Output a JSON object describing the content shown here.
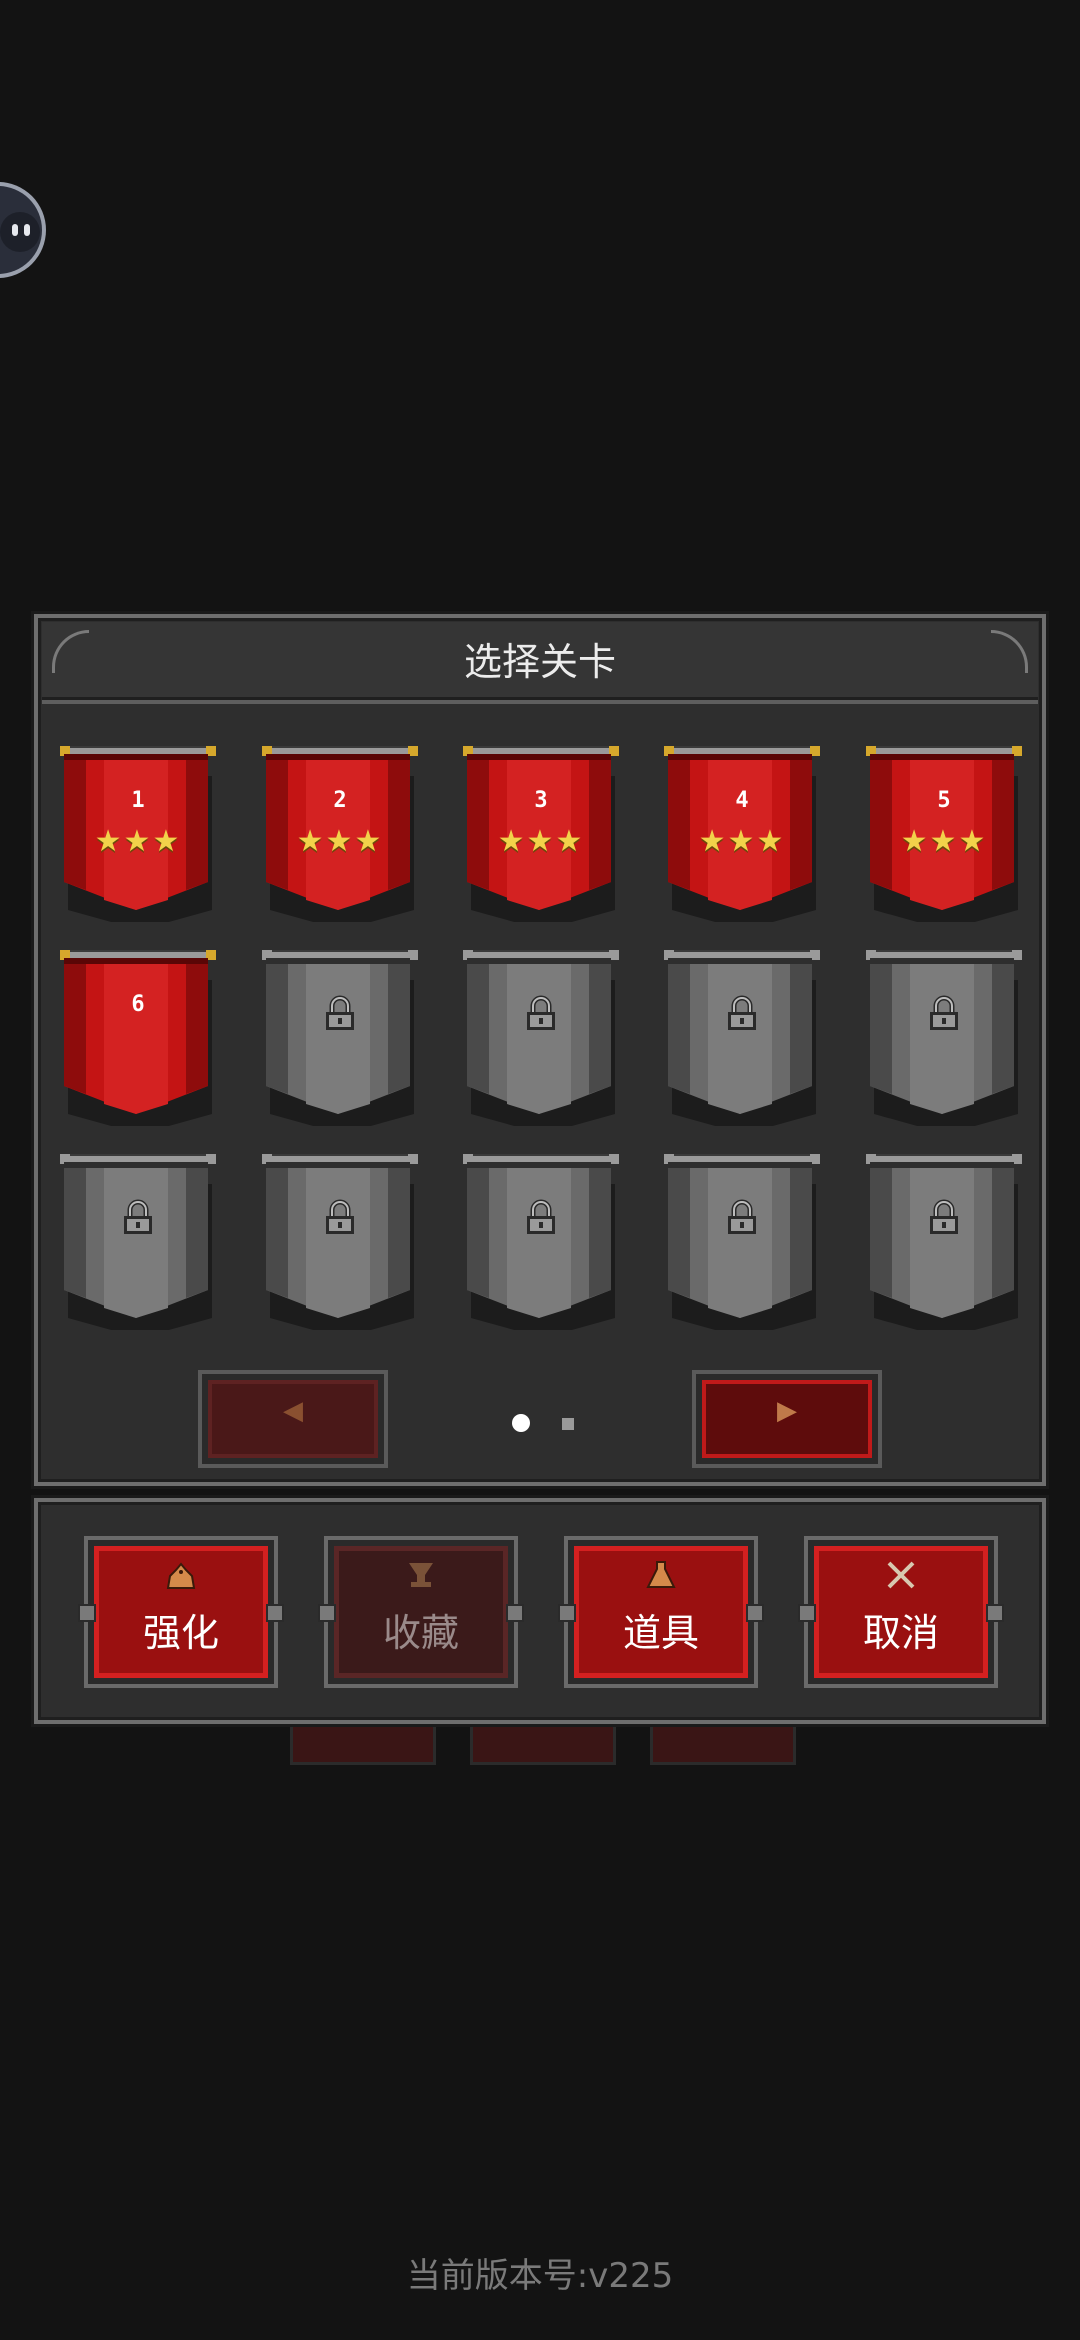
{
  "panel": {
    "title": "选择关卡"
  },
  "levels": [
    {
      "label": "1",
      "state": "cleared",
      "stars": "★★★"
    },
    {
      "label": "2",
      "state": "cleared",
      "stars": "★★★"
    },
    {
      "label": "3",
      "state": "cleared",
      "stars": "★★★"
    },
    {
      "label": "4",
      "state": "cleared",
      "stars": "★★★"
    },
    {
      "label": "5",
      "state": "cleared",
      "stars": "★★★"
    },
    {
      "label": "6",
      "state": "unlocked",
      "stars": ""
    },
    {
      "label": "",
      "state": "locked",
      "stars": ""
    },
    {
      "label": "",
      "state": "locked",
      "stars": ""
    },
    {
      "label": "",
      "state": "locked",
      "stars": ""
    },
    {
      "label": "",
      "state": "locked",
      "stars": ""
    },
    {
      "label": "",
      "state": "locked",
      "stars": ""
    },
    {
      "label": "",
      "state": "locked",
      "stars": ""
    },
    {
      "label": "",
      "state": "locked",
      "stars": ""
    },
    {
      "label": "",
      "state": "locked",
      "stars": ""
    },
    {
      "label": "",
      "state": "locked",
      "stars": ""
    }
  ],
  "pager": {
    "prev_icon": "◀",
    "next_icon": "▶",
    "current_page": 1,
    "total_pages": 2
  },
  "actions": {
    "upgrade": {
      "label": "强化",
      "icon": "pile-icon"
    },
    "collection": {
      "label": "收藏",
      "icon": "goblet-icon"
    },
    "items": {
      "label": "道具",
      "icon": "flask-icon"
    },
    "cancel": {
      "label": "取消",
      "icon": "crossed-swords-icon"
    }
  },
  "footer": {
    "version": "当前版本号:v225"
  },
  "colors": {
    "banner_red": "#c41414",
    "banner_gray": "#6a6a6a",
    "star_gold": "#f2d24a",
    "button_red": "#9a1010"
  }
}
